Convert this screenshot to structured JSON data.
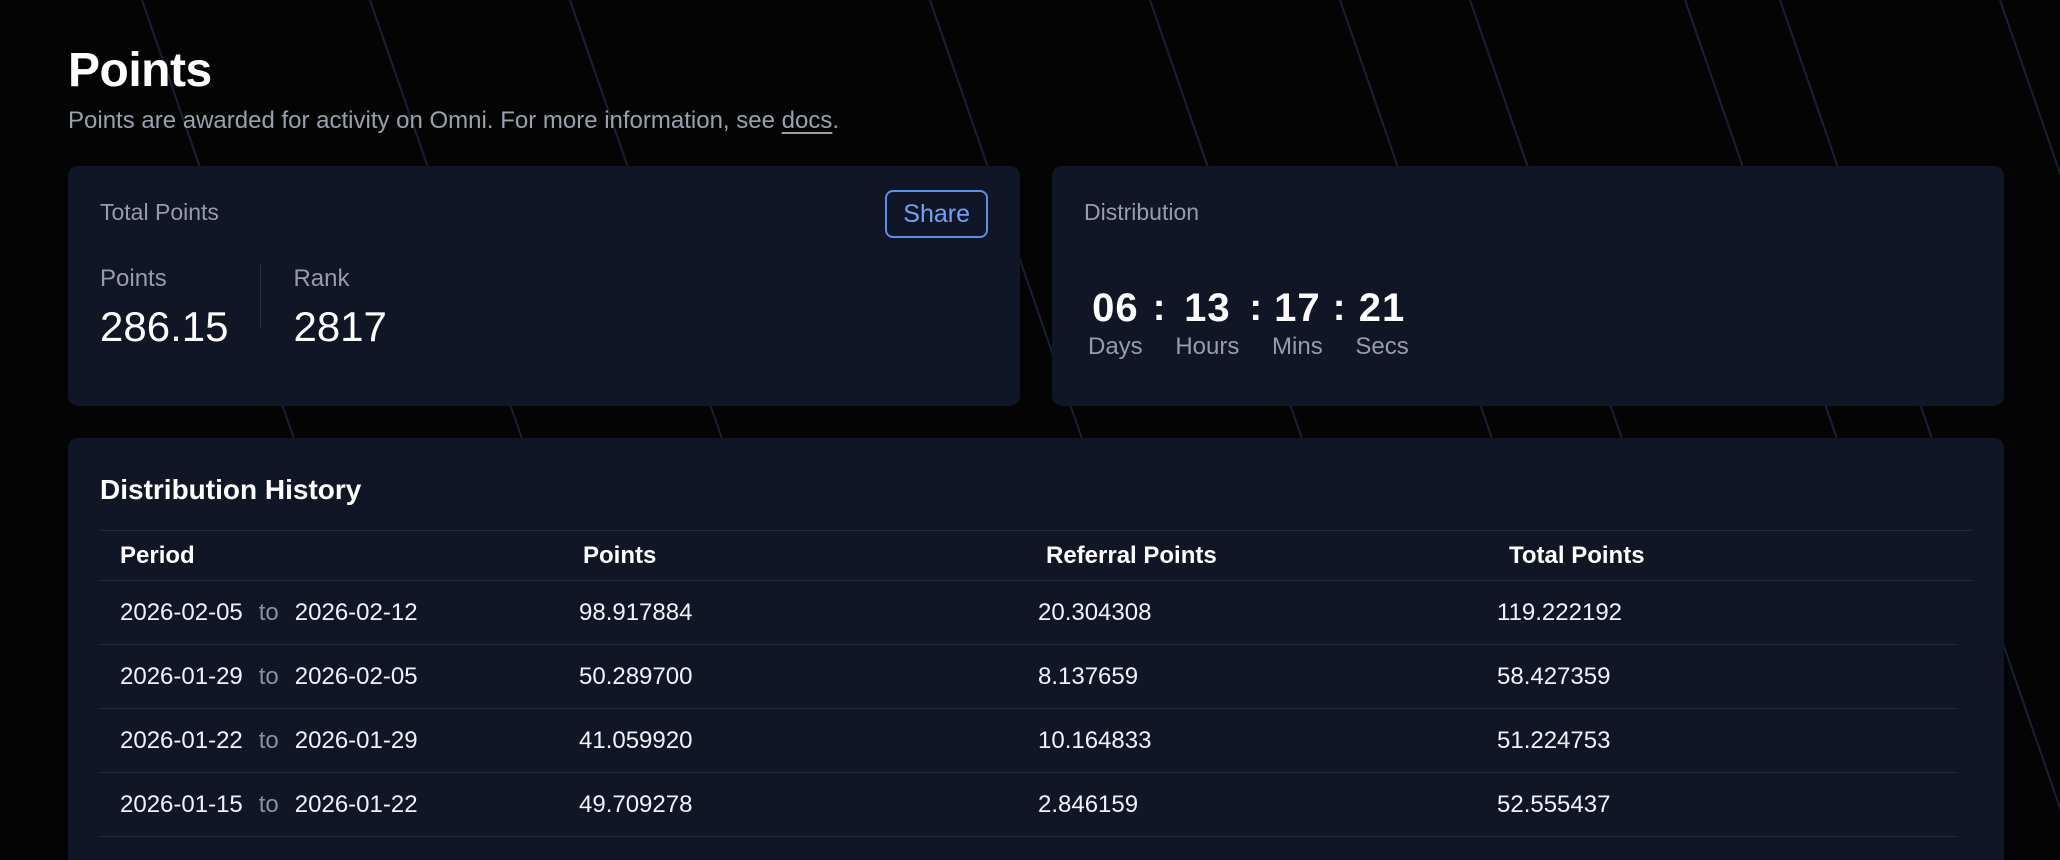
{
  "header": {
    "title": "Points",
    "subtitle_prefix": "Points are awarded for activity on Omni. For more information, see ",
    "subtitle_link": "docs",
    "subtitle_suffix": "."
  },
  "total_card": {
    "label": "Total Points",
    "share_label": "Share",
    "points_label": "Points",
    "points_value": "286.15",
    "rank_label": "Rank",
    "rank_value": "2817"
  },
  "distribution_card": {
    "label": "Distribution",
    "countdown": [
      {
        "value": "06",
        "label": "Days"
      },
      {
        "value": "13",
        "label": "Hours"
      },
      {
        "value": "17",
        "label": "Mins"
      },
      {
        "value": "21",
        "label": "Secs"
      }
    ],
    "separator": ":"
  },
  "history": {
    "title": "Distribution History",
    "columns": [
      "Period",
      "Points",
      "Referral Points",
      "Total Points"
    ],
    "to_word": "to",
    "rows": [
      {
        "start": "2026-02-05",
        "end": "2026-02-12",
        "points": "98.917884",
        "referral": "20.304308",
        "total": "119.222192"
      },
      {
        "start": "2026-01-29",
        "end": "2026-02-05",
        "points": "50.289700",
        "referral": "8.137659",
        "total": "58.427359"
      },
      {
        "start": "2026-01-22",
        "end": "2026-01-29",
        "points": "41.059920",
        "referral": "10.164833",
        "total": "51.224753"
      },
      {
        "start": "2026-01-15",
        "end": "2026-01-22",
        "points": "49.709278",
        "referral": "2.846159",
        "total": "52.555437"
      }
    ]
  },
  "colors": {
    "background": "#040405",
    "card": "#111627",
    "accent": "#6ea3f7",
    "muted_text": "#969cab"
  }
}
